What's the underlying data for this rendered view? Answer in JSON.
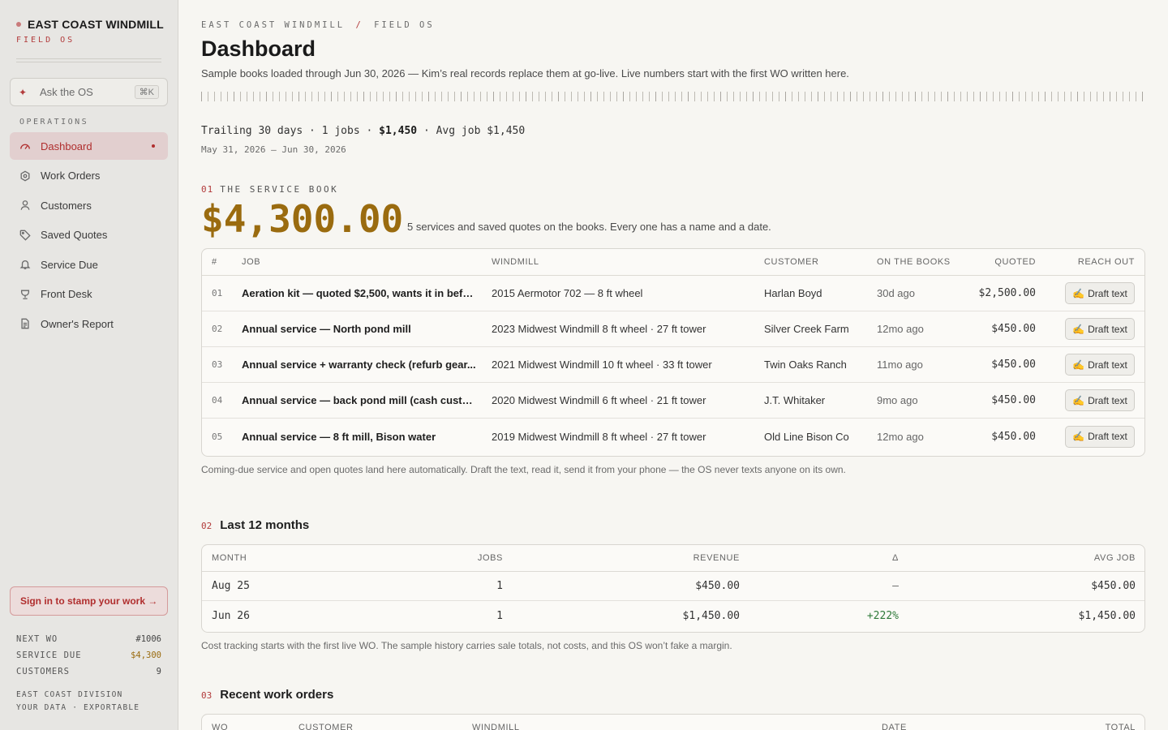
{
  "brand": {
    "name": "EAST COAST WINDMILL",
    "sub": "FIELD OS"
  },
  "ask": {
    "label": "Ask the OS",
    "shortcut": "⌘K"
  },
  "sidebar": {
    "section": "OPERATIONS",
    "items": [
      {
        "label": "Dashboard",
        "icon": "gauge-icon",
        "active": true
      },
      {
        "label": "Work Orders",
        "icon": "hexagon-icon"
      },
      {
        "label": "Customers",
        "icon": "user-icon"
      },
      {
        "label": "Saved Quotes",
        "icon": "tag-icon"
      },
      {
        "label": "Service Due",
        "icon": "bell-icon"
      },
      {
        "label": "Front Desk",
        "icon": "trophy-icon"
      },
      {
        "label": "Owner's Report",
        "icon": "document-icon"
      }
    ],
    "signin": "Sign in to stamp your work →",
    "stats": [
      {
        "label": "NEXT WO",
        "value": "#1006"
      },
      {
        "label": "SERVICE DUE",
        "value": "$4,300"
      },
      {
        "label": "CUSTOMERS",
        "value": "9"
      }
    ],
    "footer_1": "EAST COAST DIVISION",
    "footer_2": "YOUR DATA · EXPORTABLE"
  },
  "header": {
    "crumb_1": "EAST COAST WINDMILL",
    "crumb_sep": "/",
    "crumb_2": "FIELD OS",
    "title": "Dashboard",
    "subtitle": "Sample books loaded through Jun 30, 2026 — Kim’s real records replace them at go-live. Live numbers start with the first WO written here."
  },
  "trailing": {
    "prefix": "Trailing 30 days · 1 jobs · ",
    "revenue": "$1,450",
    "suffix": " · Avg job $1,450",
    "range": "May 31, 2026 – Jun 30, 2026"
  },
  "service_book": {
    "num": "01",
    "heading": "THE SERVICE BOOK",
    "amount": "$4,300.00",
    "note": "5 services and saved quotes on the books. Every one has a name and a date.",
    "columns": [
      "#",
      "JOB",
      "WINDMILL",
      "CUSTOMER",
      "ON THE BOOKS",
      "QUOTED",
      "REACH OUT"
    ],
    "button_label": "Draft text",
    "rows": [
      {
        "idx": "01",
        "job": "Aeration kit — quoted $2,500, wants it in befo...",
        "windmill": "2015 Aermotor 702 — 8 ft wheel",
        "customer": "Harlan Boyd",
        "age": "30d ago",
        "quoted": "$2,500.00"
      },
      {
        "idx": "02",
        "job": "Annual service — North pond mill",
        "windmill": "2023 Midwest Windmill 8 ft wheel · 27 ft tower",
        "customer": "Silver Creek Farm",
        "age": "12mo ago",
        "quoted": "$450.00"
      },
      {
        "idx": "03",
        "job": "Annual service + warranty check (refurb gear...",
        "windmill": "2021 Midwest Windmill 10 ft wheel · 33 ft tower",
        "customer": "Twin Oaks Ranch",
        "age": "11mo ago",
        "quoted": "$450.00"
      },
      {
        "idx": "04",
        "job": "Annual service — back pond mill (cash custo...",
        "windmill": "2020 Midwest Windmill 6 ft wheel · 21 ft tower",
        "customer": "J.T. Whitaker",
        "age": "9mo ago",
        "quoted": "$450.00"
      },
      {
        "idx": "05",
        "job": "Annual service — 8 ft mill, Bison water",
        "windmill": "2019 Midwest Windmill 8 ft wheel · 27 ft tower",
        "customer": "Old Line Bison Co",
        "age": "12mo ago",
        "quoted": "$450.00"
      }
    ],
    "footnote": "Coming-due service and open quotes land here automatically. Draft the text, read it, send it from your phone — the OS never texts anyone on its own."
  },
  "months": {
    "num": "02",
    "heading": "Last 12 months",
    "columns": [
      "MONTH",
      "JOBS",
      "REVENUE",
      "Δ",
      "AVG JOB"
    ],
    "rows": [
      {
        "month": "Aug 25",
        "jobs": "1",
        "revenue": "$450.00",
        "delta": "—",
        "avg": "$450.00"
      },
      {
        "month": "Jun 26",
        "jobs": "1",
        "revenue": "$1,450.00",
        "delta": "+222%",
        "avg": "$1,450.00"
      }
    ],
    "footnote": "Cost tracking starts with the first live WO. The sample history carries sale totals, not costs, and this OS won’t fake a margin."
  },
  "recent": {
    "num": "03",
    "heading": "Recent work orders",
    "columns": [
      "WO",
      "CUSTOMER",
      "WINDMILL",
      "DATE",
      "TOTAL"
    ]
  },
  "colors": {
    "accent": "#b02e2e",
    "gold": "#9a6b0f",
    "positive": "#2f7a3a"
  }
}
